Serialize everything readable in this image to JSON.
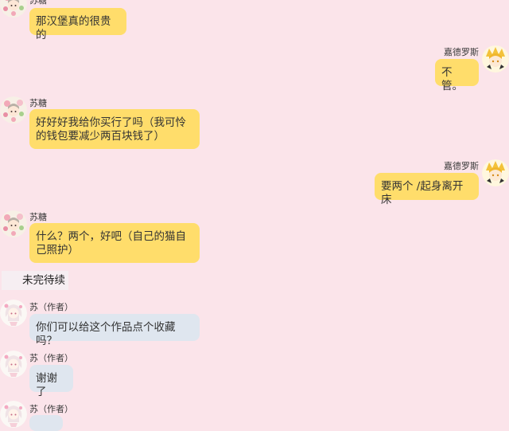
{
  "colors": {
    "background": "#fbe4ea",
    "bubble_yellow": "#ffdd6b",
    "bubble_blue": "#dfe6ef"
  },
  "messages": [
    {
      "sender": "苏糖",
      "text": "那汉堡真的很贵的",
      "side": "left",
      "color": "yellow"
    },
    {
      "sender": "嘉德罗斯",
      "text": "不管。",
      "side": "right",
      "color": "yellow"
    },
    {
      "sender": "苏糖",
      "text": "好好好我给你买行了吗（我可怜的钱包要减少两百块钱了）",
      "side": "left",
      "color": "yellow"
    },
    {
      "sender": "嘉德罗斯",
      "text": "要两个 /起身离开床",
      "side": "right",
      "color": "yellow"
    },
    {
      "sender": "苏糖",
      "text": "什么？两个，好吧（自己的猫自己照护）",
      "side": "left",
      "color": "yellow"
    },
    {
      "sender": "苏（作者）",
      "text": "你们可以给这个作品点个收藏吗？",
      "side": "left",
      "color": "blue"
    },
    {
      "sender": "苏（作者）",
      "text": "谢谢了",
      "side": "left",
      "color": "blue"
    },
    {
      "sender": "苏（作者）",
      "text": "",
      "side": "left",
      "color": "blue"
    }
  ],
  "status_label": "未完待续",
  "avatars": {
    "sutang": "avatar-icon",
    "jiadeluosi": "avatar-icon",
    "author": "avatar-icon"
  }
}
